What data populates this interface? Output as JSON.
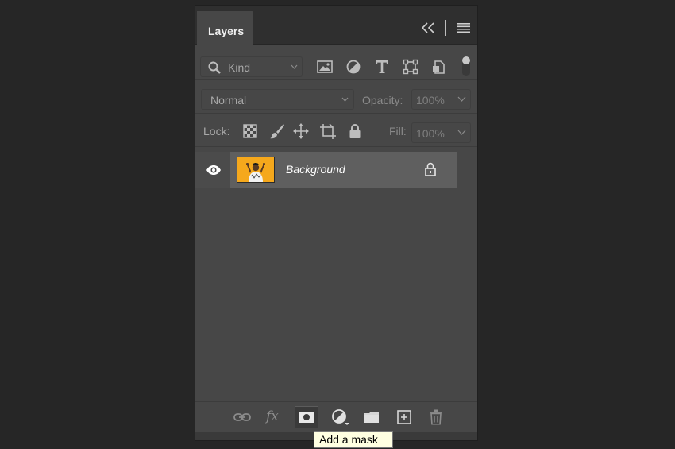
{
  "panel": {
    "tab_label": "Layers"
  },
  "filter": {
    "kind_label": "Kind",
    "icons": [
      "image-filter-icon",
      "adjustment-filter-icon",
      "type-filter-icon",
      "shape-filter-icon",
      "smart-object-filter-icon"
    ]
  },
  "blend": {
    "mode": "Normal",
    "opacity_label": "Opacity:",
    "opacity_value": "100%"
  },
  "lock": {
    "label": "Lock:",
    "icons": [
      "lock-transparent-pixels-icon",
      "lock-image-pixels-icon",
      "lock-position-icon",
      "lock-artboard-icon",
      "lock-all-icon"
    ],
    "fill_label": "Fill:",
    "fill_value": "100%"
  },
  "layers": [
    {
      "name": "Background",
      "visible": true,
      "locked": true
    }
  ],
  "bottom_bar": {
    "buttons": [
      "link-layers",
      "layer-style",
      "add-mask",
      "new-fill-adjustment",
      "new-group",
      "new-layer",
      "delete-layer"
    ]
  },
  "tooltip": {
    "text": "Add a mask"
  },
  "colors": {
    "thumbnail_bg": "#f5a81c",
    "tooltip_bg": "#ffffe1"
  }
}
